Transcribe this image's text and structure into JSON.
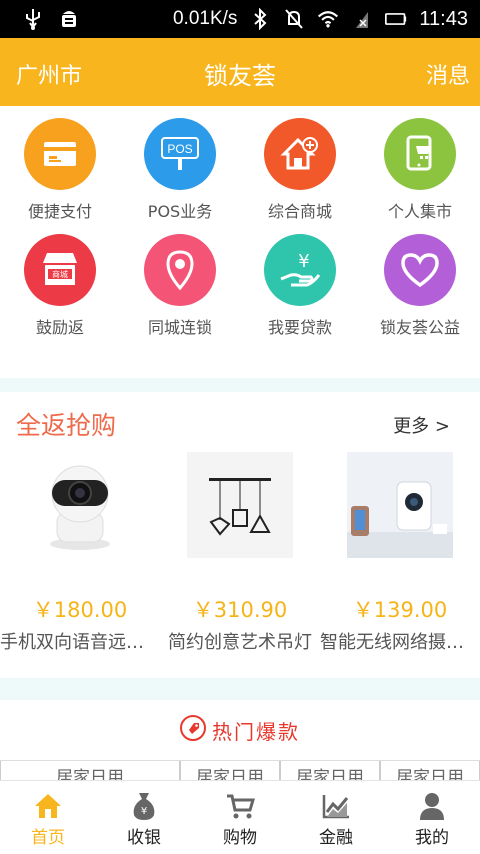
{
  "status_bar": {
    "network_speed": "0.01K/s",
    "time": "11:43",
    "icons": [
      "usb-icon",
      "android-debug-icon",
      "bluetooth-icon",
      "mute-icon",
      "wifi-icon",
      "signal-icon",
      "battery-icon"
    ]
  },
  "header": {
    "city": "广州市",
    "title": "锁友荟",
    "messages": "消息",
    "color": "#f9b51d"
  },
  "grid": [
    {
      "label": "便捷支付",
      "icon": "card-icon",
      "color": "#f7a11f"
    },
    {
      "label": "POS业务",
      "icon": "pos-icon",
      "color": "#2c9bea",
      "icon_text": "POS"
    },
    {
      "label": "综合商城",
      "icon": "house-plus-icon",
      "color": "#f1592a"
    },
    {
      "label": "个人集市",
      "icon": "tablet-cart-icon",
      "color": "#8cc43f"
    },
    {
      "label": "鼓励返",
      "icon": "shop-icon",
      "color": "#ec3b46",
      "icon_text": "商城"
    },
    {
      "label": "同城连锁",
      "icon": "location-pin-icon",
      "color": "#f45476"
    },
    {
      "label": "我要贷款",
      "icon": "hand-yen-icon",
      "color": "#2fc5ad",
      "icon_text": "¥"
    },
    {
      "label": "锁友荟公益",
      "icon": "heart-icon",
      "color": "#b35fd8"
    }
  ],
  "promo": {
    "title": "全返抢购",
    "more": "更多 >",
    "products": [
      {
        "price": "￥180.00",
        "name": "手机双向语音远程监控摄像头",
        "image": "camera-image"
      },
      {
        "price": "￥310.90",
        "name": "简约创意艺术吊灯",
        "image": "pendant-lamp-image"
      },
      {
        "price": "￥139.00",
        "name": "智能无线网络摄像机",
        "image": "smart-camera-image"
      }
    ]
  },
  "hot": {
    "title": "热门爆款",
    "categories": [
      "居家日用",
      "居家日用",
      "居家日用",
      "居家日用"
    ]
  },
  "tabs": [
    {
      "label": "首页",
      "icon": "home-icon",
      "active": true
    },
    {
      "label": "收银",
      "icon": "money-bag-icon",
      "active": false
    },
    {
      "label": "购物",
      "icon": "cart-icon",
      "active": false
    },
    {
      "label": "金融",
      "icon": "chart-icon",
      "active": false
    },
    {
      "label": "我的",
      "icon": "user-icon",
      "active": false
    }
  ],
  "colors": {
    "accent": "#f9b51d",
    "promo_title": "#ef6a4a",
    "price": "#f6b419",
    "hot": "#e8382e"
  }
}
